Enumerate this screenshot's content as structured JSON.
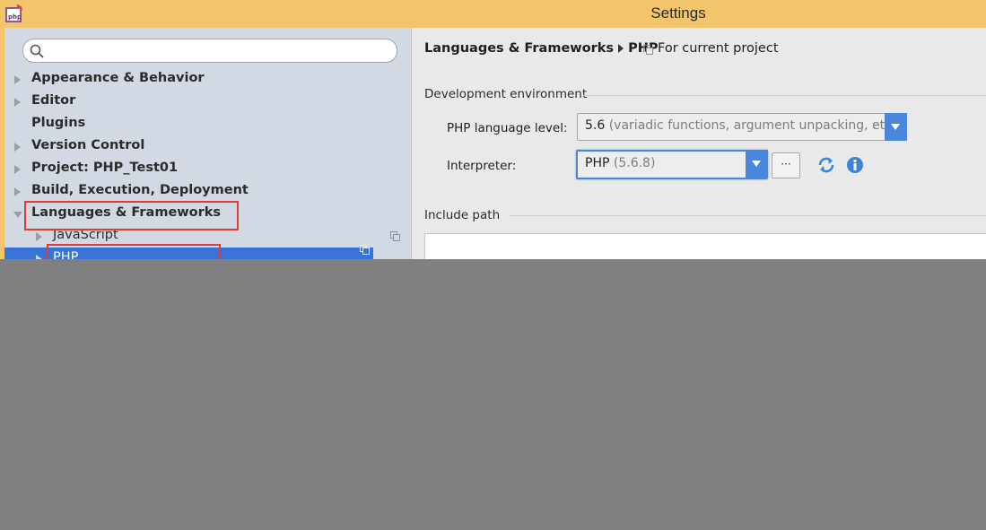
{
  "window": {
    "title": "Settings",
    "app_icon": "phpstorm-icon"
  },
  "search": {
    "value": "",
    "placeholder": ""
  },
  "sidebar": {
    "items": [
      {
        "label": "Appearance & Behavior",
        "expandable": true
      },
      {
        "label": "Editor",
        "expandable": true
      },
      {
        "label": "Plugins",
        "expandable": false
      },
      {
        "label": "Version Control",
        "expandable": true
      },
      {
        "label": "Project: PHP_Test01",
        "expandable": true
      },
      {
        "label": "Build, Execution, Deployment",
        "expandable": true
      },
      {
        "label": "Languages & Frameworks",
        "expandable": true,
        "expanded": true
      },
      {
        "label": "JavaScript",
        "expandable": true,
        "child": true
      },
      {
        "label": "PHP",
        "expandable": true,
        "child": true,
        "selected": true
      }
    ]
  },
  "breadcrumb": {
    "parent": "Languages & Frameworks",
    "current": "PHP",
    "scope_label": "For current project"
  },
  "development_environment": {
    "title": "Development environment",
    "language_level_label": "PHP language level:",
    "language_level_value": "5.6",
    "language_level_detail": "(variadic functions, argument unpacking, etc.)",
    "interpreter_label": "Interpreter:",
    "interpreter_value": "PHP",
    "interpreter_detail": "(5.6.8)",
    "more_button": "···"
  },
  "include_path": {
    "title": "Include path"
  },
  "colors": {
    "titlebar": "#f2c46b",
    "sidebar": "#d3d9e2",
    "selection": "#3874d8",
    "highlight": "#e03c36",
    "accent": "#4a86dc",
    "overlay": "#808080"
  }
}
